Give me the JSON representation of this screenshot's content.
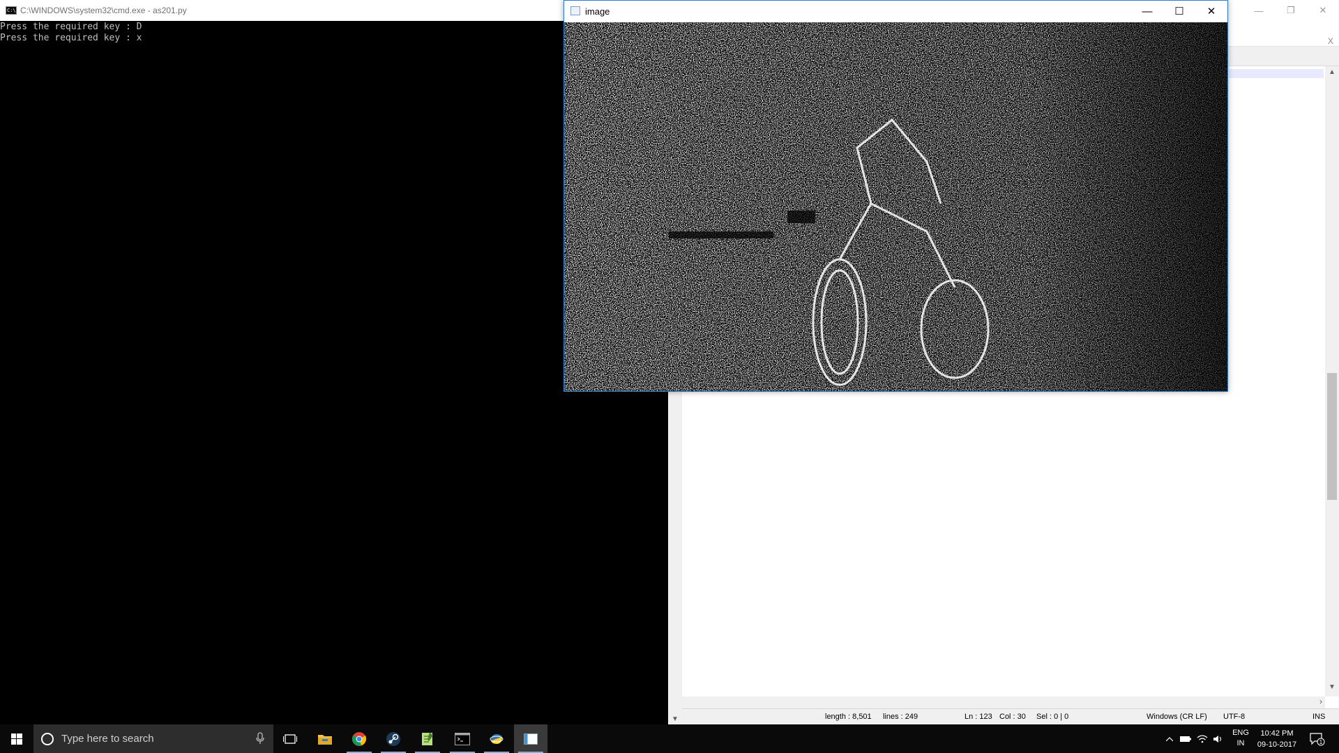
{
  "console": {
    "title": "C:\\WINDOWS\\system32\\cmd.exe - as201.py",
    "icon_label": "C:\\",
    "lines": [
      "Press the required key : D",
      "Press the required key : x"
    ]
  },
  "image_window": {
    "title": "image",
    "buttons": {
      "minimize": "—",
      "maximize": "☐",
      "close": "✕"
    }
  },
  "editor": {
    "doc_close": "X",
    "statusbar": {
      "length": "length : 8,501",
      "lines": "lines : 249",
      "ln": "Ln : 123",
      "col": "Col : 30",
      "sel": "Sel : 0 | 0",
      "eol": "Windows (CR LF)",
      "encoding": "UTF-8",
      "mode": "INS"
    }
  },
  "taskbar": {
    "search_placeholder": "Type here to search",
    "apps": [
      "task-view-icon",
      "file-explorer-icon",
      "chrome-icon",
      "steam-icon",
      "notepadpp-icon",
      "cmd-icon",
      "python-icon",
      "image-window-icon"
    ],
    "tray": {
      "lang_top": "ENG",
      "lang_bottom": "IN",
      "time": "10:42 PM",
      "date": "09-10-2017",
      "notification_count": "1"
    }
  },
  "colors": {
    "console_bg": "#000000",
    "console_text": "#c0c0c0",
    "taskbar_bg": "#0a0a0a",
    "accent": "#2b79d0"
  }
}
